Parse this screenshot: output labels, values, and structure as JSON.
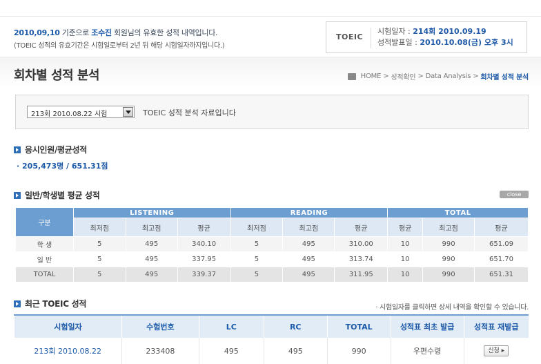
{
  "notice": {
    "date": "2010,09,10",
    "text1": " 기준으로 ",
    "name": "조수진",
    "text2": " 회원님의 유효한 성적 내역입니다.",
    "line2": "(TOEIC 성적의 유효기간은 시험일로부터 2년 뒤 해당 시험일자까지입니다.)"
  },
  "exam_box": {
    "tag": "TOEIC",
    "exam_date_label": "시험일자 : ",
    "exam_date_value": "214회  2010.09.19",
    "result_date_label": "성적발표일 : ",
    "result_date_value": "2010.10.08(금) 오후 3시"
  },
  "page_title": "회차별 성적 분석",
  "breadcrumb": {
    "home": "HOME",
    "sep1": ">",
    "item1": "성적확인",
    "sep2": ">",
    "item2": "Data Analysis",
    "sep3": ">",
    "current": "회차별 성적 분석"
  },
  "selector": {
    "selected": "213회  2010.08.22 시험",
    "desc": "TOEIC 성적 분석 자료입니다"
  },
  "section_applicants": {
    "title": "응시인원/평균성적",
    "stat": "· 205,473명 / 651.31점"
  },
  "section_average": {
    "title": "일반/학생별 평균 성적",
    "close_label": "close",
    "headers": {
      "gubun": "구분",
      "listening": "LISTENING",
      "reading": "READING",
      "total": "TOTAL",
      "sub": [
        "최저점",
        "최고점",
        "평균",
        "최저점",
        "최고점",
        "평균",
        "평균",
        "최고점",
        "평균"
      ]
    },
    "rows": [
      {
        "label": "학 생",
        "cells": [
          "5",
          "495",
          "340.10",
          "5",
          "495",
          "310.00",
          "10",
          "990",
          "651.09"
        ]
      },
      {
        "label": "일 반",
        "cells": [
          "5",
          "495",
          "337.95",
          "5",
          "495",
          "313.74",
          "10",
          "990",
          "651.70"
        ]
      },
      {
        "label": "TOTAL",
        "cells": [
          "5",
          "495",
          "339.37",
          "5",
          "495",
          "311.95",
          "10",
          "990",
          "651.31"
        ]
      }
    ]
  },
  "section_recent": {
    "title": "최근 TOEIC 성적",
    "note": "· 시험일자를 클릭하면 상세 내역을 확인할 수 있습니다.",
    "headers": [
      "시험일자",
      "수험번호",
      "LC",
      "RC",
      "TOTAL",
      "성적표 최초 발급",
      "성적표 재발급"
    ],
    "row": {
      "date": "213회  2010.08.22",
      "number": "233408",
      "lc": "495",
      "rc": "495",
      "total": "990",
      "first_issue": "우편수령",
      "reissue": "신청 ▸"
    }
  }
}
